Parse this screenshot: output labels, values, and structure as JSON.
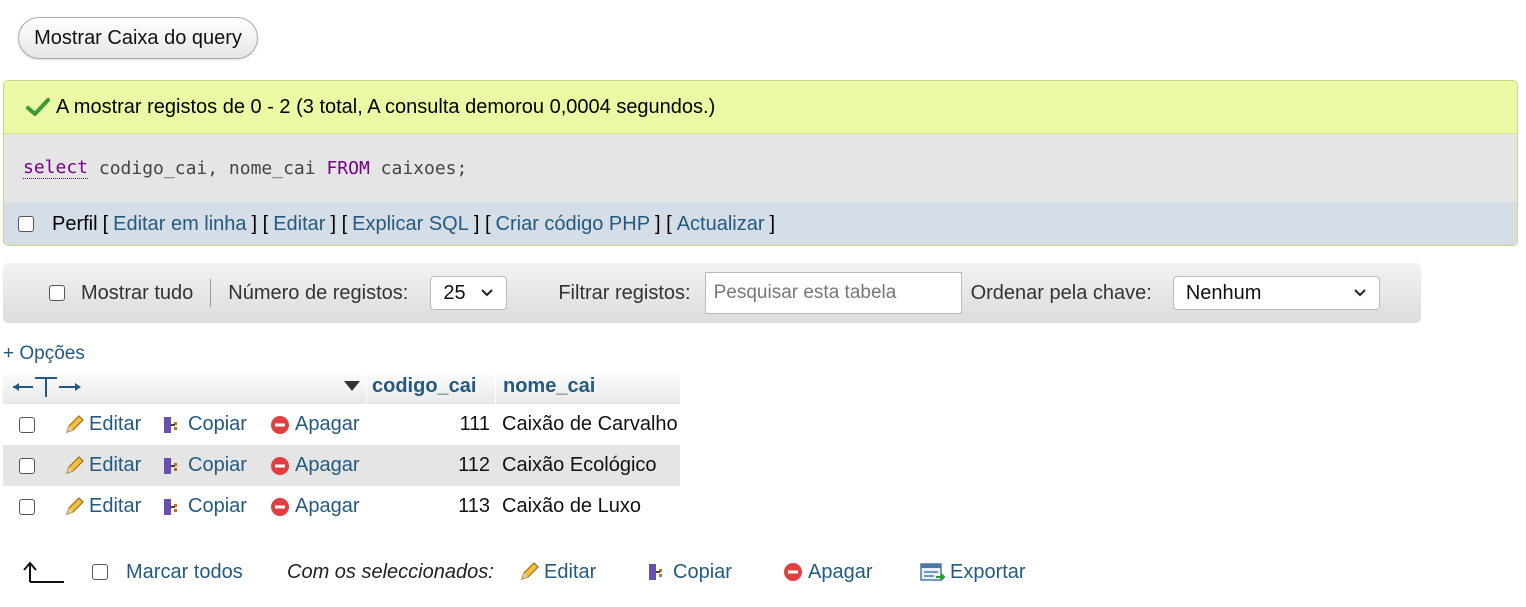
{
  "top": {
    "show_query_box": "Mostrar Caixa do query"
  },
  "result": {
    "message": "A mostrar registos de 0 - 2 (3 total, A consulta demorou 0,0004 segundos.)",
    "sql": {
      "kw_select": "select",
      "columns": " codigo_cai, nome_cai ",
      "kw_from": "FROM",
      "table": " caixoes;"
    },
    "tools": {
      "profiling": "Perfil",
      "links": [
        "Editar em linha",
        "Editar",
        "Explicar SQL",
        "Criar código PHP",
        "Actualizar"
      ]
    }
  },
  "navbar": {
    "show_all": "Mostrar tudo",
    "num_rows_label": "Número de registos:",
    "num_rows_value": "25",
    "filter_label": "Filtrar registos:",
    "filter_placeholder": "Pesquisar esta tabela",
    "sort_label": "Ordenar pela chave:",
    "sort_value": "Nenhum"
  },
  "options_link": "+ Opções",
  "table": {
    "columns": [
      "codigo_cai",
      "nome_cai"
    ],
    "actions": {
      "edit": "Editar",
      "copy": "Copiar",
      "delete": "Apagar"
    },
    "rows": [
      {
        "codigo_cai": "111",
        "nome_cai": "Caixão de Carvalho"
      },
      {
        "codigo_cai": "112",
        "nome_cai": "Caixão Ecológico"
      },
      {
        "codigo_cai": "113",
        "nome_cai": "Caixão de Luxo"
      }
    ]
  },
  "bulk": {
    "check_all": "Marcar todos",
    "with_selected": "Com os seleccionados:",
    "edit": "Editar",
    "copy": "Copiar",
    "delete": "Apagar",
    "export": "Exportar"
  }
}
